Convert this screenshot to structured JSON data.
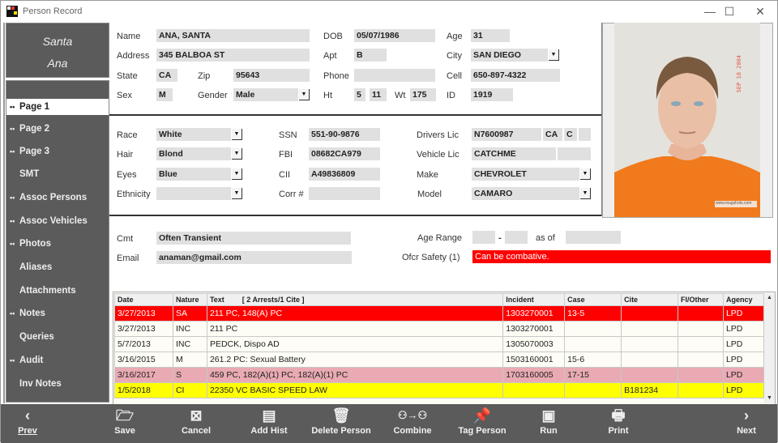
{
  "window": {
    "title": "Person Record",
    "minimize": "—",
    "maximize": "☐",
    "close": "✕"
  },
  "person_name": {
    "first": "Santa",
    "last": "Ana"
  },
  "sidebar": {
    "items": [
      {
        "label": "Page 1",
        "dots": true,
        "active": true
      },
      {
        "label": "Page 2",
        "dots": true
      },
      {
        "label": "Page 3",
        "dots": true
      },
      {
        "label": "SMT",
        "dots": false
      },
      {
        "label": "Assoc Persons",
        "dots": true
      },
      {
        "label": "Assoc Vehicles",
        "dots": true
      },
      {
        "label": "Photos",
        "dots": true
      },
      {
        "label": "Aliases",
        "dots": false
      },
      {
        "label": "Attachments",
        "dots": false
      },
      {
        "label": "Notes",
        "dots": true
      },
      {
        "label": "Queries",
        "dots": false
      },
      {
        "label": "Audit",
        "dots": true
      },
      {
        "label": "Inv Notes",
        "dots": false
      }
    ]
  },
  "section1": {
    "name_label": "Name",
    "name": "ANA, SANTA",
    "dob_label": "DOB",
    "dob": "05/07/1986",
    "age_label": "Age",
    "age": "31",
    "address_label": "Address",
    "address": "345 BALBOA ST",
    "apt_label": "Apt",
    "apt": "B",
    "city_label": "City",
    "city": "SAN DIEGO",
    "state_label": "State",
    "state": "CA",
    "zip_label": "Zip",
    "zip": "95643",
    "phone_label": "Phone",
    "phone": "",
    "cell_label": "Cell",
    "cell": "650-897-4322",
    "sex_label": "Sex",
    "sex": "M",
    "gender_label": "Gender",
    "gender": "Male",
    "ht_label": "Ht",
    "ht_ft": "5",
    "ht_in": "11",
    "wt_label": "Wt",
    "wt": "175",
    "id_label": "ID",
    "id": "1919"
  },
  "section2": {
    "race_label": "Race",
    "race": "White",
    "hair_label": "Hair",
    "hair": "Blond",
    "eyes_label": "Eyes",
    "eyes": "Blue",
    "ethnicity_label": "Ethnicity",
    "ethnicity": "",
    "ssn_label": "SSN",
    "ssn": "551-90-9876",
    "fbi_label": "FBI",
    "fbi": "08682CA979",
    "cii_label": "CII",
    "cii": "A49836809",
    "corr_label": "Corr #",
    "corr": "",
    "dl_label": "Drivers Lic",
    "dl": "N7600987",
    "dl_state": "CA",
    "dl_class": "C",
    "dl_extra": "",
    "vl_label": "Vehicle Lic",
    "vl": "CATCHME",
    "vl_extra": "",
    "make_label": "Make",
    "make": "CHEVROLET",
    "model_label": "Model",
    "model": "CAMARO"
  },
  "photo": {
    "date_stamp": "SEP 18 2004",
    "watermark": "www.mugshots.com"
  },
  "section3": {
    "cmt_label": "Cmt",
    "cmt": "Often Transient",
    "email_label": "Email",
    "email": "anaman@gmail.com",
    "age_range_label": "Age Range",
    "age_from": "",
    "age_dash": "-",
    "age_to": "",
    "as_of_label": "as of",
    "as_of": "",
    "ofcr_safety_label": "Ofcr Safety (1)",
    "ofcr_safety": "Can be combative."
  },
  "history": {
    "columns": [
      "Date",
      "Nature",
      "Text",
      "[ 2 Arrests/1 Cite ]",
      "Incident",
      "Case",
      "Cite",
      "FI/Other",
      "Agency"
    ],
    "rows": [
      {
        "date": "3/27/2013",
        "nature": "SA",
        "text": "211 PC, 148(A) PC",
        "incident": "1303270001",
        "case": "13-5",
        "cite": "",
        "fi": "",
        "agency": "LPD",
        "style": "red"
      },
      {
        "date": "3/27/2013",
        "nature": "INC",
        "text": "211 PC",
        "incident": "1303270001",
        "case": "",
        "cite": "",
        "fi": "",
        "agency": "LPD",
        "style": "white"
      },
      {
        "date": "5/7/2013",
        "nature": "INC",
        "text": "PEDCK, Dispo AD",
        "incident": "1305070003",
        "case": "",
        "cite": "",
        "fi": "",
        "agency": "LPD",
        "style": "white"
      },
      {
        "date": "3/16/2015",
        "nature": "M",
        "text": "261.2 PC: Sexual Battery",
        "incident": "1503160001",
        "case": "15-6",
        "cite": "",
        "fi": "",
        "agency": "LPD",
        "style": "white"
      },
      {
        "date": "3/16/2017",
        "nature": "S",
        "text": "459 PC, 182(A)(1) PC, 182(A)(1) PC",
        "incident": "1703160005",
        "case": "17-15",
        "cite": "",
        "fi": "",
        "agency": "LPD",
        "style": "pink"
      },
      {
        "date": "1/5/2018",
        "nature": "CI",
        "text": "22350 VC  BASIC SPEED LAW",
        "incident": "",
        "case": "",
        "cite": "B181234",
        "fi": "",
        "agency": "LPD",
        "style": "yellow"
      }
    ]
  },
  "toolbar": {
    "prev": "Prev",
    "save": "Save",
    "cancel": "Cancel",
    "add_hist": "Add Hist",
    "delete_person": "Delete Person",
    "combine": "Combine",
    "tag_person": "Tag Person",
    "run": "Run",
    "print": "Print",
    "next": "Next"
  },
  "colors": {
    "row_red": "#ff0000",
    "row_pink": "#e9aab3",
    "row_yellow": "#ffff00",
    "panel_gray": "#5b5b5b",
    "field_gray": "#e0e0e0"
  }
}
